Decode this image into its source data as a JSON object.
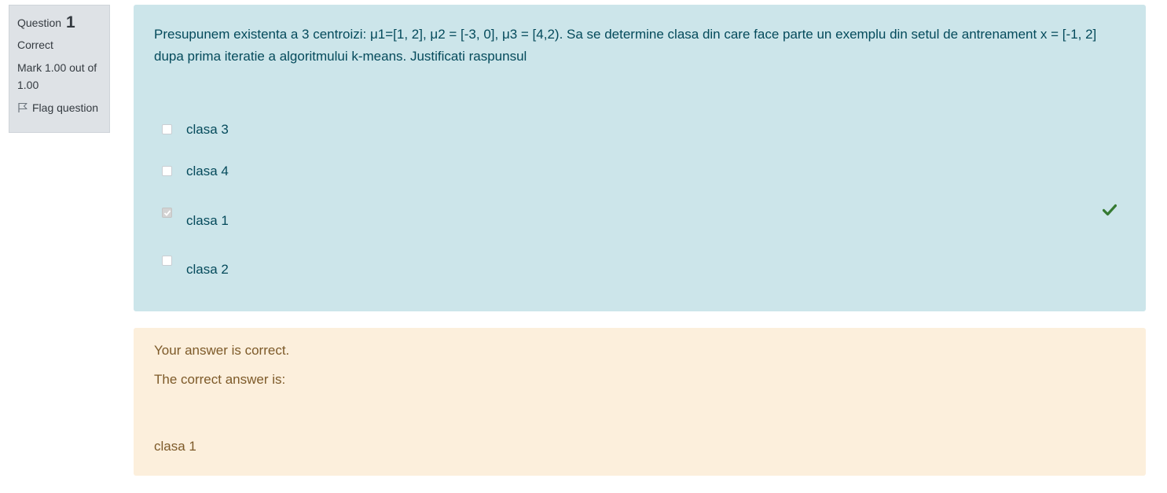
{
  "info": {
    "question_label": "Question",
    "question_number": "1",
    "state": "Correct",
    "grade": "Mark 1.00 out of 1.00",
    "flag_label": "Flag question"
  },
  "question": {
    "text": "Presupunem existenta a 3 centroizi: μ1=[1, 2], μ2 = [-3, 0], μ3 = [4,2). Sa se determine clasa din care face parte un exemplu din setul de antrenament x = [-1, 2] dupa prima iteratie a algoritmului k-means. Justificati raspunsul",
    "options": [
      {
        "label": "clasa 3",
        "checked": false
      },
      {
        "label": "clasa 4",
        "checked": false
      },
      {
        "label": "clasa 1",
        "checked": true,
        "correct": true
      },
      {
        "label": "clasa 2",
        "checked": false
      }
    ]
  },
  "feedback": {
    "result": "Your answer is correct.",
    "correct_intro": "The correct answer is:",
    "correct_answer": "clasa 1"
  },
  "colors": {
    "formulation_bg": "#cce5ea",
    "formulation_text": "#044a5b",
    "outcome_bg": "#fcefdc",
    "outcome_text": "#7d5a29",
    "correct_tick": "#357a32"
  }
}
